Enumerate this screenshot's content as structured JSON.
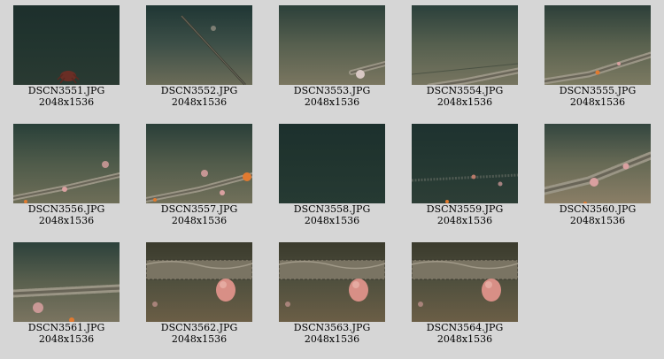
{
  "gallery": {
    "items": [
      {
        "filename": "DSCN3551.JPG",
        "dimensions": "2048x1536",
        "scene": "dark-crab"
      },
      {
        "filename": "DSCN3552.JPG",
        "dimensions": "2048x1536",
        "scene": "diagonal-cable"
      },
      {
        "filename": "DSCN3553.JPG",
        "dimensions": "2048x1536",
        "scene": "pipe-corner"
      },
      {
        "filename": "DSCN3554.JPG",
        "dimensions": "2048x1536",
        "scene": "pipe-low"
      },
      {
        "filename": "DSCN3555.JPG",
        "dimensions": "2048x1536",
        "scene": "pipe-diagonal"
      },
      {
        "filename": "DSCN3556.JPG",
        "dimensions": "2048x1536",
        "scene": "pipe-anemones"
      },
      {
        "filename": "DSCN3557.JPG",
        "dimensions": "2048x1536",
        "scene": "pipe-starfish"
      },
      {
        "filename": "DSCN3558.JPG",
        "dimensions": "2048x1536",
        "scene": "dark-empty"
      },
      {
        "filename": "DSCN3559.JPG",
        "dimensions": "2048x1536",
        "scene": "dark-pipe"
      },
      {
        "filename": "DSCN3560.JPG",
        "dimensions": "2048x1536",
        "scene": "pipe-close"
      },
      {
        "filename": "DSCN3561.JPG",
        "dimensions": "2048x1536",
        "scene": "pipe-bottom"
      },
      {
        "filename": "DSCN3562.JPG",
        "dimensions": "2048x1536",
        "scene": "pipe-creature"
      },
      {
        "filename": "DSCN3563.JPG",
        "dimensions": "2048x1536",
        "scene": "pipe-creature"
      },
      {
        "filename": "DSCN3564.JPG",
        "dimensions": "2048x1536",
        "scene": "pipe-creature"
      }
    ]
  },
  "colors": {
    "background": "#d6d6d6",
    "water_dark": "#1f3330",
    "water_mid": "#3a4f45",
    "sediment": "#6b6a52",
    "sediment_warm": "#6a5a40",
    "pipe": "#9a9585",
    "anemone": "#d9a0a0",
    "starfish": "#e07a30"
  }
}
